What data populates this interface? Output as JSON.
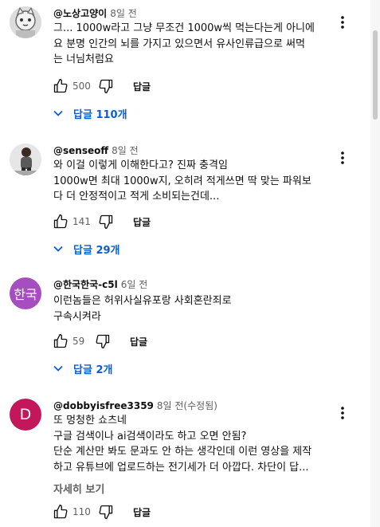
{
  "comments": [
    {
      "author": "@노상고양이",
      "time": "8일 전",
      "lines": [
        "그...  1000w라고 그냥 무조건 1000w씩 먹는다는게 아니에",
        "요 분명 인간의 뇌를 가지고 있으면서 유사인류급으로 써먹",
        "는 너님처럼요"
      ],
      "likes": "500",
      "reply_label": "답글",
      "replies_label": "답글 110개"
    },
    {
      "author": "@senseoff",
      "time": "8일 전",
      "lines": [
        "와 이걸 이렇게 이해한다고? 진짜 충격임",
        "1000w면 최대 1000w지, 오히려 적게쓰면 딱 맞는 파워보",
        "다 더 안정적이고 적게 소비되는건데..."
      ],
      "likes": "141",
      "reply_label": "답글",
      "replies_label": "답글 29개"
    },
    {
      "author": "@한국한국-c5l",
      "time": "6일 전",
      "avatar_text": "한국",
      "avatar_color": "#a64dbf",
      "lines": [
        "이런놈들은 허위사실유포랑 사회혼란죄로",
        "구속시켜라"
      ],
      "likes": "59",
      "reply_label": "답글",
      "replies_label": "답글 2개"
    },
    {
      "author": "@dobbyisfree3359",
      "time": "8일 전(수정됨)",
      "avatar_text": "D",
      "avatar_color": "#c2185b",
      "lines": [
        "또 멍청한 쇼츠네",
        "구글 검색이나 ai검색이라도 하고 오면 안됨?",
        "단순 계산만 봐도 문과도 안 하는 생각인데 이런 영상을 제작",
        "하고 유튜브에 업로드하는 전기세가 더 아깝다. 차단이 답..."
      ],
      "read_more": "자세히 보기",
      "likes": "110",
      "reply_label": "답글"
    }
  ],
  "icons": {
    "like": "thumb-up-icon",
    "dislike": "thumb-down-icon",
    "more": "more-vert-icon",
    "expand": "chevron-down-icon"
  },
  "colors": {
    "link_blue": "#065fd4",
    "meta_gray": "#606060"
  }
}
